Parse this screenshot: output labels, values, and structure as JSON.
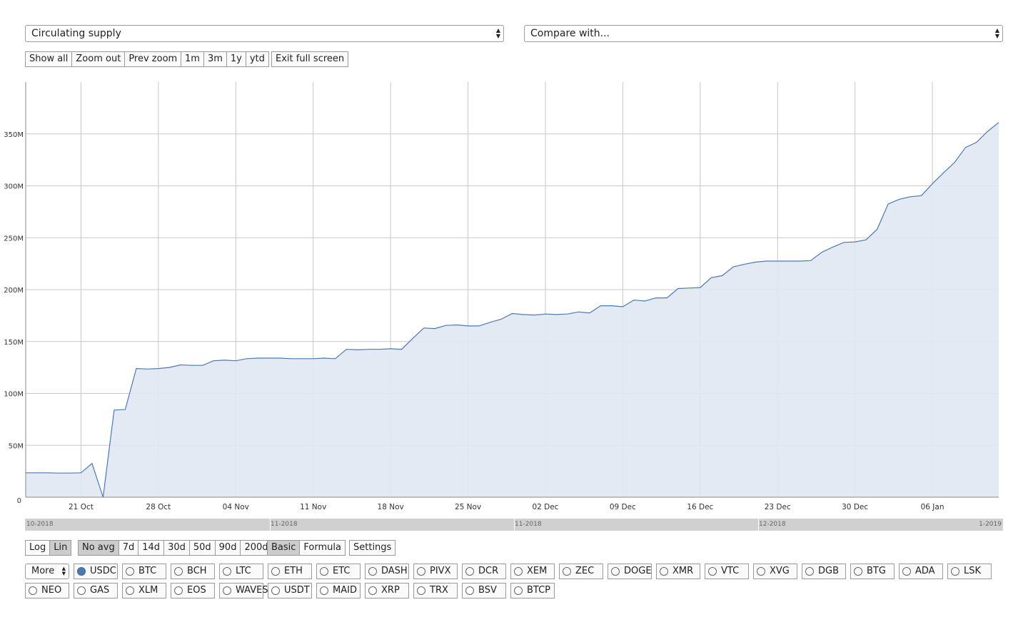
{
  "selects": {
    "metric": "Circulating supply",
    "compare": "Compare with..."
  },
  "zoom_buttons": [
    "Show all",
    "Zoom out",
    "Prev zoom"
  ],
  "range_buttons": [
    "1m",
    "3m",
    "1y",
    "ytd"
  ],
  "fullscreen_button": "Exit full screen",
  "scale_buttons": [
    {
      "label": "Log",
      "active": false
    },
    {
      "label": "Lin",
      "active": true
    }
  ],
  "avg_buttons": [
    {
      "label": "No avg",
      "active": true
    },
    {
      "label": "7d",
      "active": false
    },
    {
      "label": "14d",
      "active": false
    },
    {
      "label": "30d",
      "active": false
    },
    {
      "label": "50d",
      "active": false
    },
    {
      "label": "90d",
      "active": false
    },
    {
      "label": "200d",
      "active": false
    }
  ],
  "mode_buttons": [
    {
      "label": "Basic",
      "active": true
    },
    {
      "label": "Formula",
      "active": false
    }
  ],
  "settings_button": "Settings",
  "more_select": "More",
  "coins_row1": [
    {
      "label": "USDC",
      "selected": true
    },
    {
      "label": "BTC",
      "selected": false
    },
    {
      "label": "BCH",
      "selected": false
    },
    {
      "label": "LTC",
      "selected": false
    },
    {
      "label": "ETH",
      "selected": false
    },
    {
      "label": "ETC",
      "selected": false
    },
    {
      "label": "DASH",
      "selected": false
    },
    {
      "label": "PIVX",
      "selected": false
    },
    {
      "label": "DCR",
      "selected": false
    },
    {
      "label": "XEM",
      "selected": false
    },
    {
      "label": "ZEC",
      "selected": false
    },
    {
      "label": "DOGE",
      "selected": false
    },
    {
      "label": "XMR",
      "selected": false
    },
    {
      "label": "VTC",
      "selected": false
    },
    {
      "label": "XVG",
      "selected": false
    },
    {
      "label": "DGB",
      "selected": false
    },
    {
      "label": "BTG",
      "selected": false
    },
    {
      "label": "ADA",
      "selected": false
    },
    {
      "label": "LSK",
      "selected": false
    }
  ],
  "coins_row2": [
    {
      "label": "NEO",
      "selected": false
    },
    {
      "label": "GAS",
      "selected": false
    },
    {
      "label": "XLM",
      "selected": false
    },
    {
      "label": "EOS",
      "selected": false
    },
    {
      "label": "WAVES",
      "selected": false
    },
    {
      "label": "USDT",
      "selected": false
    },
    {
      "label": "MAID",
      "selected": false
    },
    {
      "label": "XRP",
      "selected": false
    },
    {
      "label": "TRX",
      "selected": false
    },
    {
      "label": "BSV",
      "selected": false
    },
    {
      "label": "BTCP",
      "selected": false
    }
  ],
  "navigator": {
    "labels": [
      "10-2018",
      "11-2018",
      "11-2018",
      "12-2018",
      "1-2019"
    ]
  },
  "colors": {
    "line": "#4a7ab5",
    "fill": "#e1e8f2",
    "grid": "#c8c8c8"
  },
  "chart_data": {
    "type": "area",
    "title": "",
    "xlabel": "",
    "ylabel": "",
    "ylim": [
      0,
      400000000
    ],
    "grid": true,
    "x_ticks": [
      "21 Oct",
      "28 Oct",
      "04 Nov",
      "11 Nov",
      "18 Nov",
      "25 Nov",
      "02 Dec",
      "09 Dec",
      "16 Dec",
      "23 Dec",
      "30 Dec",
      "06 Jan"
    ],
    "y_ticks": [
      "0",
      "50M",
      "100M",
      "150M",
      "200M",
      "250M",
      "300M",
      "350M"
    ],
    "x_range": [
      "2018-10-16",
      "2019-01-12"
    ],
    "series": [
      {
        "x": [
          "2018-10-16",
          "2018-10-17",
          "2018-10-18",
          "2018-10-19",
          "2018-10-20",
          "2018-10-21",
          "2018-10-22",
          "2018-10-23",
          "2018-10-24",
          "2018-10-25",
          "2018-10-26",
          "2018-10-27",
          "2018-10-28",
          "2018-10-29",
          "2018-10-30",
          "2018-10-31",
          "2018-11-01",
          "2018-11-02",
          "2018-11-03",
          "2018-11-04",
          "2018-11-05",
          "2018-11-06",
          "2018-11-07",
          "2018-11-08",
          "2018-11-09",
          "2018-11-10",
          "2018-11-11",
          "2018-11-12",
          "2018-11-13",
          "2018-11-14",
          "2018-11-15",
          "2018-11-16",
          "2018-11-17",
          "2018-11-18",
          "2018-11-19",
          "2018-11-20",
          "2018-11-21",
          "2018-11-22",
          "2018-11-23",
          "2018-11-24",
          "2018-11-25",
          "2018-11-26",
          "2018-11-27",
          "2018-11-28",
          "2018-11-29",
          "2018-11-30",
          "2018-12-01",
          "2018-12-02",
          "2018-12-03",
          "2018-12-04",
          "2018-12-05",
          "2018-12-06",
          "2018-12-07",
          "2018-12-08",
          "2018-12-09",
          "2018-12-10",
          "2018-12-11",
          "2018-12-12",
          "2018-12-13",
          "2018-12-14",
          "2018-12-15",
          "2018-12-16",
          "2018-12-17",
          "2018-12-18",
          "2018-12-19",
          "2018-12-20",
          "2018-12-21",
          "2018-12-22",
          "2018-12-23",
          "2018-12-24",
          "2018-12-25",
          "2018-12-26",
          "2018-12-27",
          "2018-12-28",
          "2018-12-29",
          "2018-12-30",
          "2018-12-31",
          "2019-01-01",
          "2019-01-02",
          "2019-01-03",
          "2019-01-04",
          "2019-01-05",
          "2019-01-06",
          "2019-01-07",
          "2019-01-08",
          "2019-01-09",
          "2019-01-10",
          "2019-01-11",
          "2019-01-12"
        ],
        "values": [
          23500000,
          23500000,
          23500000,
          23200000,
          23200000,
          23500000,
          32500000,
          0,
          84000000,
          84500000,
          124000000,
          123500000,
          124000000,
          125000000,
          127500000,
          127000000,
          127000000,
          131500000,
          132000000,
          131500000,
          133500000,
          134000000,
          134000000,
          134000000,
          133500000,
          133500000,
          133500000,
          134000000,
          133500000,
          142500000,
          142000000,
          142500000,
          142500000,
          143000000,
          142500000,
          153000000,
          163000000,
          162500000,
          165500000,
          166000000,
          165000000,
          165000000,
          168500000,
          171500000,
          177000000,
          176000000,
          175500000,
          176500000,
          176000000,
          176500000,
          178500000,
          177500000,
          184500000,
          184500000,
          183500000,
          190000000,
          189000000,
          192000000,
          192000000,
          201000000,
          201500000,
          202000000,
          211500000,
          213500000,
          222000000,
          224500000,
          226500000,
          227500000,
          227500000,
          227500000,
          227500000,
          228000000,
          236000000,
          241000000,
          245500000,
          246000000,
          248000000,
          258000000,
          282500000,
          287000000,
          289500000,
          290500000,
          302000000,
          312500000,
          322500000,
          337000000,
          342000000,
          352500000,
          361000000
        ]
      }
    ]
  }
}
